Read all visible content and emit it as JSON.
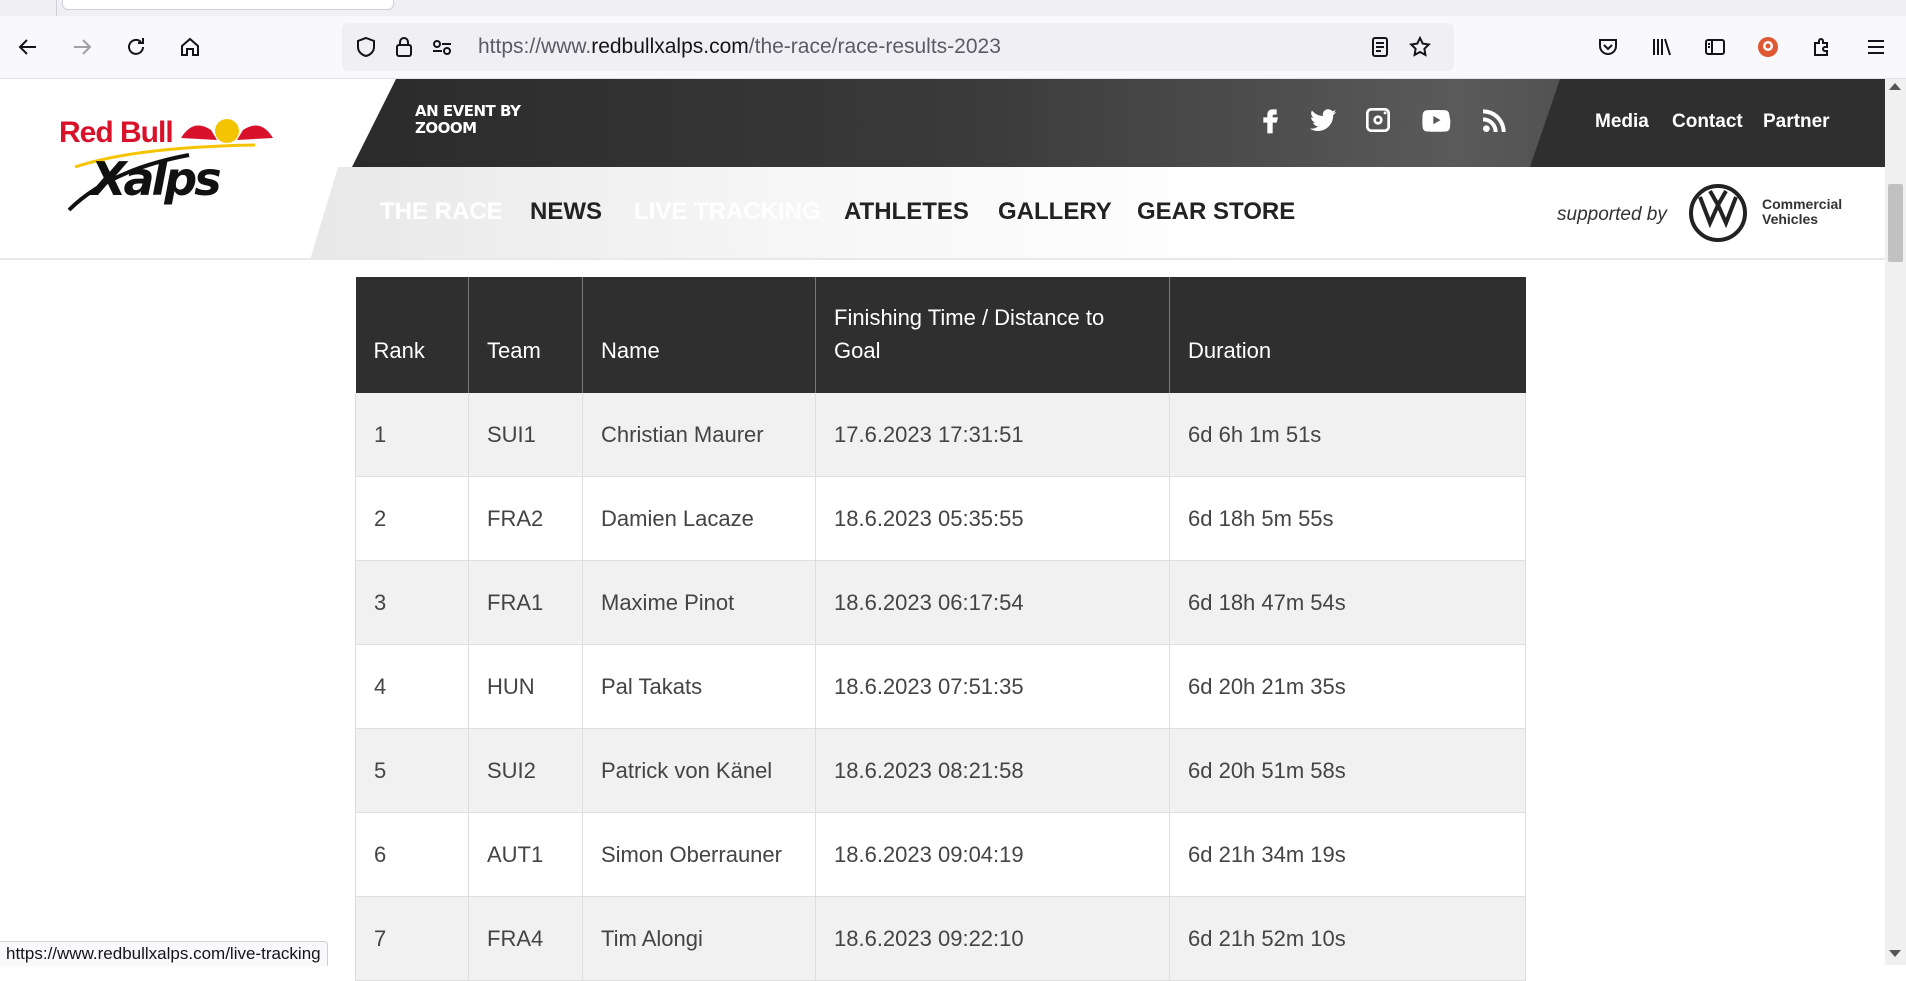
{
  "browser": {
    "url_prefix": "https://www.",
    "url_host": "redbullxalps.com",
    "url_path": "/the-race/race-results-2023",
    "status_url": "https://www.redbullxalps.com/live-tracking"
  },
  "header": {
    "event_by_line1": "AN EVENT BY",
    "event_by_line2": "ZOOOM",
    "top_links": [
      "Media",
      "Contact",
      "Partner"
    ],
    "social_icons": [
      "facebook-icon",
      "twitter-icon",
      "instagram-icon",
      "youtube-icon",
      "rss-icon"
    ],
    "nav": [
      {
        "label": "THE RACE",
        "active": true
      },
      {
        "label": "NEWS",
        "active": false
      },
      {
        "label": "LIVE TRACKING",
        "active": true
      },
      {
        "label": "ATHLETES",
        "active": false
      },
      {
        "label": "GALLERY",
        "active": false
      },
      {
        "label": "GEAR STORE",
        "active": false
      }
    ],
    "supported_by": "supported by",
    "sponsor_line1": "Commercial",
    "sponsor_line2": "Vehicles"
  },
  "table": {
    "headers": [
      "Rank",
      "Team",
      "Name",
      "Finishing Time / Distance to Goal",
      "Duration"
    ],
    "rows": [
      {
        "rank": "1",
        "team": "SUI1",
        "name": "Christian Maurer",
        "finish": "17.6.2023 17:31:51",
        "duration": "6d 6h 1m 51s"
      },
      {
        "rank": "2",
        "team": "FRA2",
        "name": "Damien Lacaze",
        "finish": "18.6.2023 05:35:55",
        "duration": "6d 18h 5m 55s"
      },
      {
        "rank": "3",
        "team": "FRA1",
        "name": "Maxime Pinot",
        "finish": "18.6.2023 06:17:54",
        "duration": "6d 18h 47m 54s"
      },
      {
        "rank": "4",
        "team": "HUN",
        "name": "Pal Takats",
        "finish": "18.6.2023 07:51:35",
        "duration": "6d 20h 21m 35s"
      },
      {
        "rank": "5",
        "team": "SUI2",
        "name": "Patrick von Känel",
        "finish": "18.6.2023 08:21:58",
        "duration": "6d 20h 51m 58s"
      },
      {
        "rank": "6",
        "team": "AUT1",
        "name": "Simon Oberrauner",
        "finish": "18.6.2023 09:04:19",
        "duration": "6d 21h 34m 19s"
      },
      {
        "rank": "7",
        "team": "FRA4",
        "name": "Tim Alongi",
        "finish": "18.6.2023 09:22:10",
        "duration": "6d 21h 52m 10s"
      }
    ]
  },
  "colors": {
    "header_dark": "#2f2f2f",
    "nav_active": "#5d5d5d",
    "row_alt": "#f1f1f1",
    "brand_red": "#d9112b",
    "brand_yellow": "#f5c400"
  }
}
